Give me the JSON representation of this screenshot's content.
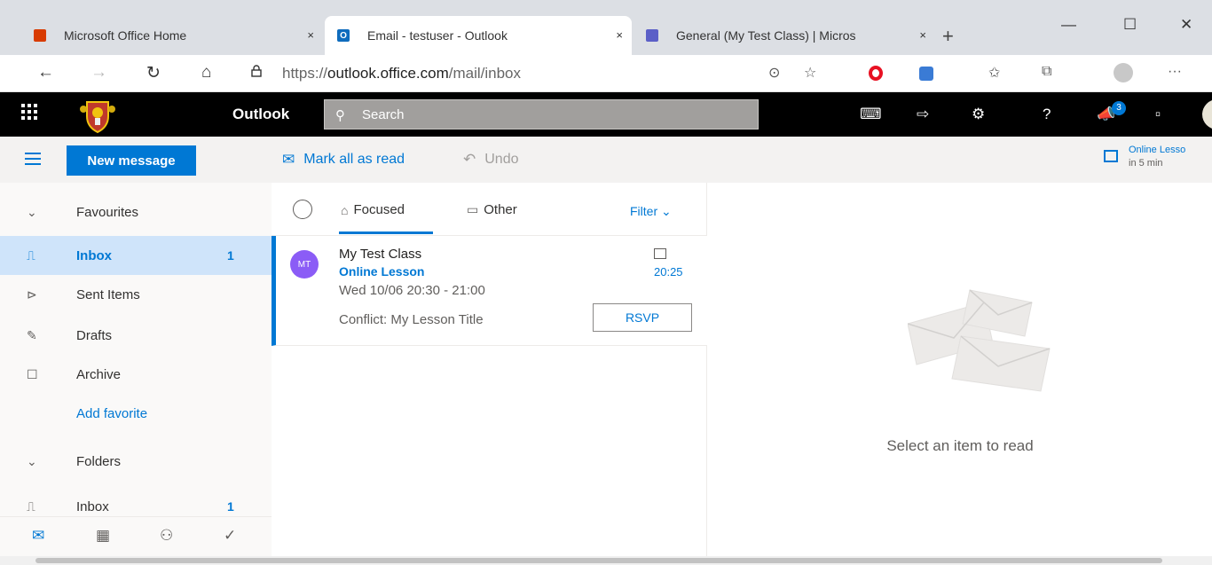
{
  "browser": {
    "tabs": [
      {
        "label": "Microsoft Office Home",
        "close": "×"
      },
      {
        "label": "Email - testuser - Outlook",
        "close": "×"
      },
      {
        "label": "General (My Test Class) | Micros",
        "close": "×"
      }
    ],
    "new_tab": "+",
    "window_controls": {
      "minimize": "—",
      "maximize": "☐",
      "close": "✕"
    },
    "nav": {
      "back": "←",
      "forward": "→",
      "refresh": "↻",
      "home": "⌂"
    },
    "url_prefix": "https://",
    "url_host": "outlook.office.com",
    "url_path": "/mail/inbox",
    "address_icons": {
      "tracking": "⊙",
      "favorite": "☆",
      "favorites": "✩",
      "collections": "⧉",
      "more": "···"
    }
  },
  "outlook": {
    "app_name": "Outlook",
    "search": {
      "placeholder": "Search",
      "icon": "search-icon"
    },
    "header_icons": {
      "chat": "⌨",
      "forward": "⇨",
      "settings": "⚙",
      "help": "?",
      "notifications": "📣",
      "feedback": "▫"
    },
    "notification_count": "3"
  },
  "commands": {
    "new_message": "New message",
    "mark_all_as_read": "Mark all as read",
    "undo": "Undo",
    "reminder_title": "Online Lesso",
    "reminder_subtitle": "in 5 min"
  },
  "folders": {
    "favourites_label": "Favourites",
    "items": [
      {
        "label": "Inbox",
        "count": "1",
        "icon": "inbox-icon"
      },
      {
        "label": "Sent Items",
        "count": "",
        "icon": "send-icon"
      },
      {
        "label": "Drafts",
        "count": "",
        "icon": "pencil-icon"
      },
      {
        "label": "Archive",
        "count": "",
        "icon": "archive-icon"
      }
    ],
    "add_favorite": "Add favorite",
    "folders_label": "Folders",
    "folders_inbox": {
      "label": "Inbox",
      "count": "1"
    }
  },
  "message_list": {
    "tabs": {
      "focused": "Focused",
      "other": "Other"
    },
    "filter": "Filter ⌄",
    "messages": [
      {
        "avatar_initials": "MT",
        "sender": "My Test Class",
        "subject": "Online Lesson",
        "event_time": "Wed 10/06 20:30 - 21:00",
        "conflict": "Conflict: My Lesson Title",
        "time": "20:25",
        "rsvp": "RSVP"
      }
    ]
  },
  "reading_pane": {
    "empty_text": "Select an item to read"
  },
  "colors": {
    "accent": "#0078d4",
    "header_bg": "#000000",
    "selected_folder_bg": "#cfe4fa",
    "avatar_bg": "#8b5cf6"
  }
}
